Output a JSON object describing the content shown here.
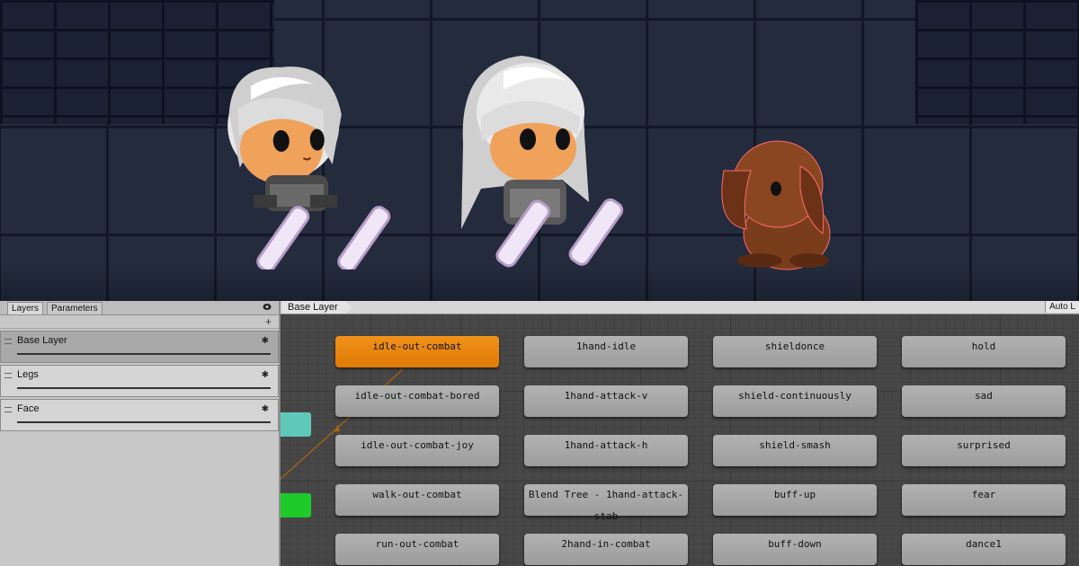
{
  "scene": {
    "characters": [
      "knight-girl-sitting",
      "knight-girl-standing",
      "brown-rabbit"
    ]
  },
  "layers_panel": {
    "tabs": [
      "Layers",
      "Parameters"
    ],
    "items": [
      {
        "label": "Base Layer",
        "selected": true
      },
      {
        "label": "Legs",
        "selected": false
      },
      {
        "label": "Face",
        "selected": false
      }
    ]
  },
  "graph": {
    "breadcrumb": "Base Layer",
    "auto_live": "Auto L",
    "states": [
      [
        "idle-out-combat",
        "idle-out-combat-bored",
        "idle-out-combat-joy",
        "walk-out-combat",
        "run-out-combat"
      ],
      [
        "1hand-idle",
        "1hand-attack-v",
        "1hand-attack-h",
        "Blend Tree - 1hand-attack-stab",
        "2hand-in-combat"
      ],
      [
        "shieldonce",
        "shield-continuously",
        "shield-smash",
        "buff-up",
        "buff-down"
      ],
      [
        "hold",
        "sad",
        "surprised",
        "fear",
        "dance1"
      ]
    ]
  },
  "colors": {
    "default_state": "#e88510",
    "entry_node": "#5fc8b8",
    "any_state_node": "#1ec92a",
    "state_node": "#a8a8a8"
  }
}
